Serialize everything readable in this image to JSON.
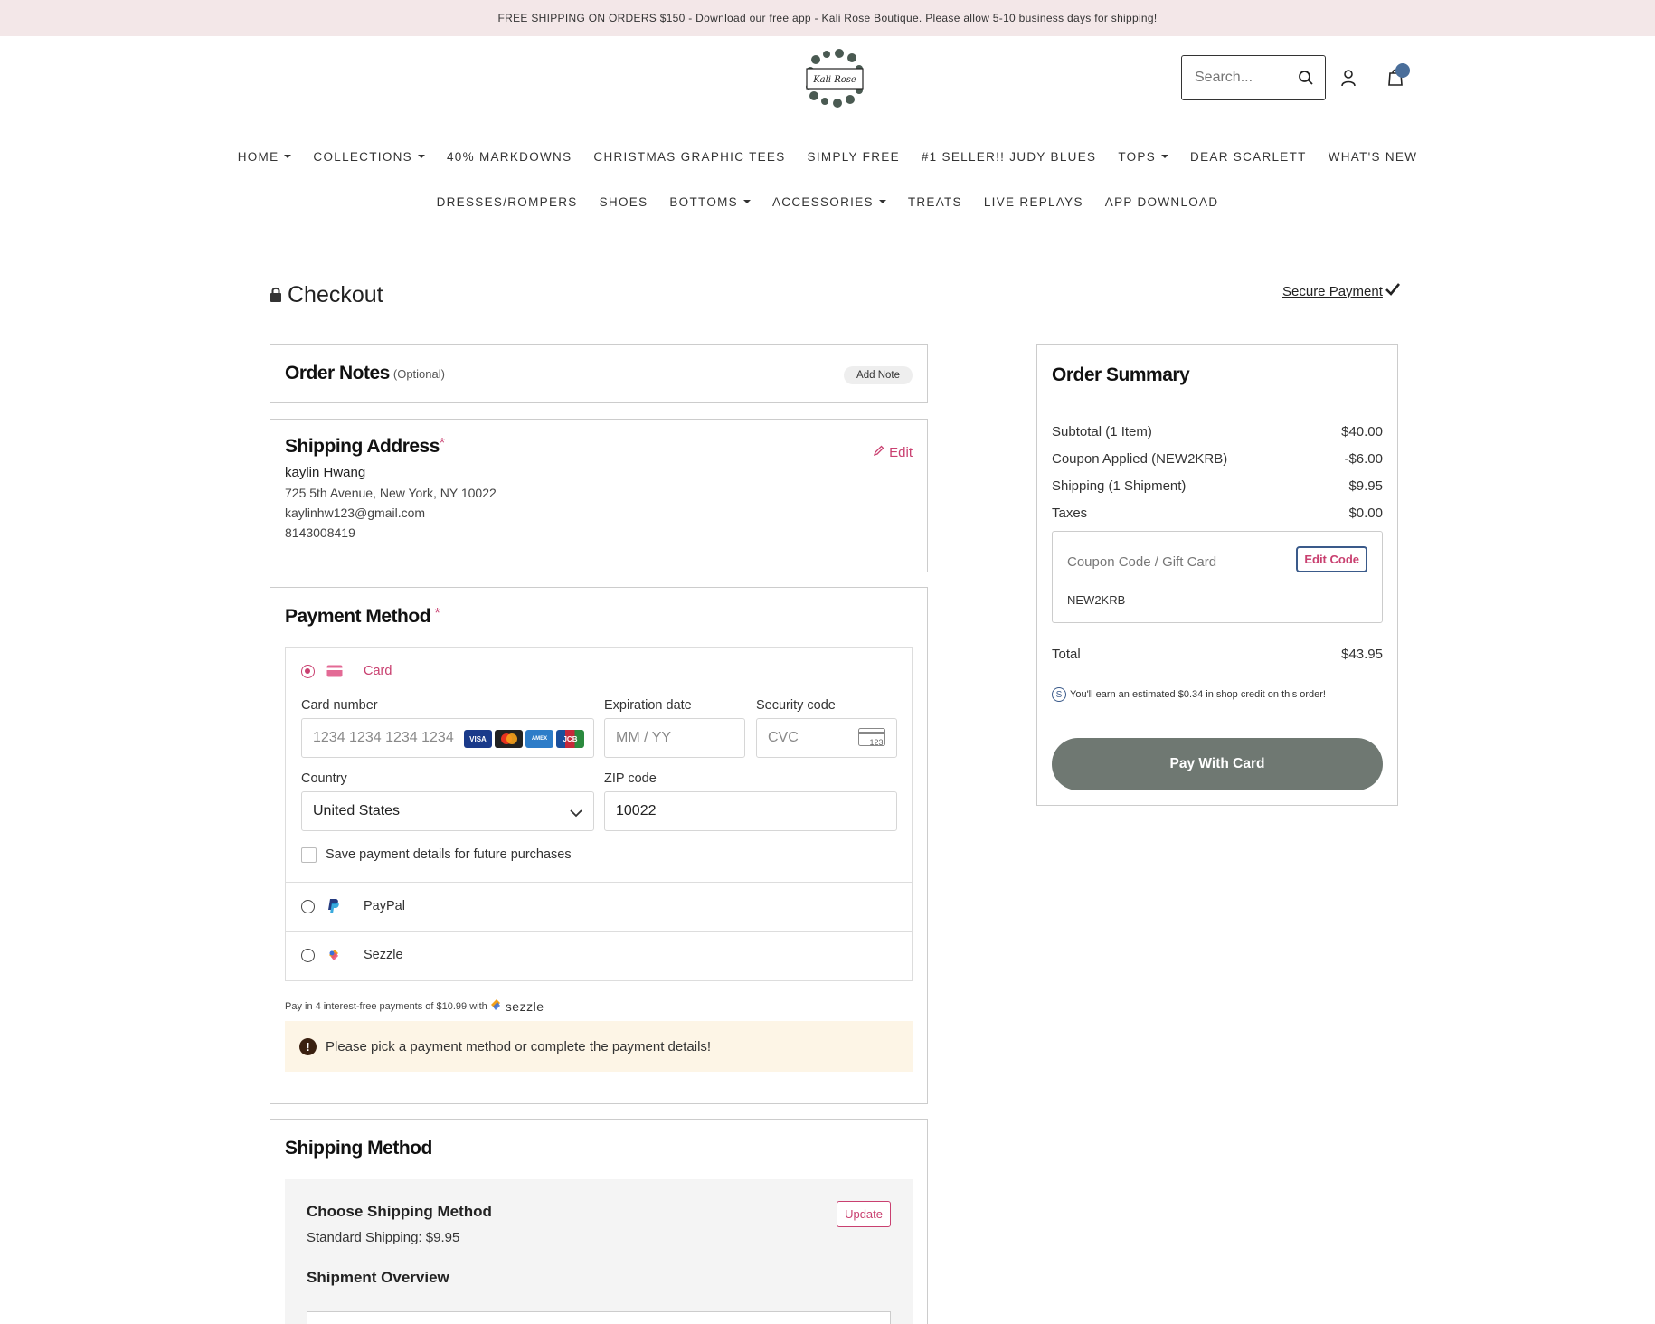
{
  "announcement": "FREE SHIPPING ON ORDERS $150 - Download our free app - Kali Rose Boutique. Please allow 5-10 business days for shipping!",
  "header": {
    "logo_text": "Kali Rose",
    "search_placeholder": "Search..."
  },
  "nav": {
    "row1": [
      {
        "label": "HOME",
        "dropdown": true
      },
      {
        "label": "COLLECTIONS",
        "dropdown": true
      },
      {
        "label": "40% MARKDOWNS",
        "dropdown": false
      },
      {
        "label": "CHRISTMAS GRAPHIC TEES",
        "dropdown": false
      },
      {
        "label": "SIMPLY FREE",
        "dropdown": false
      },
      {
        "label": "#1 SELLER!! JUDY BLUES",
        "dropdown": false
      },
      {
        "label": "TOPS",
        "dropdown": true
      },
      {
        "label": "DEAR SCARLETT",
        "dropdown": false
      },
      {
        "label": "WHAT'S NEW",
        "dropdown": false
      }
    ],
    "row2": [
      {
        "label": "DRESSES/ROMPERS",
        "dropdown": false
      },
      {
        "label": "SHOES",
        "dropdown": false
      },
      {
        "label": "BOTTOMS",
        "dropdown": true
      },
      {
        "label": "ACCESSORIES",
        "dropdown": true
      },
      {
        "label": "TREATS",
        "dropdown": false
      },
      {
        "label": "LIVE REPLAYS",
        "dropdown": false
      },
      {
        "label": "APP DOWNLOAD",
        "dropdown": false
      }
    ]
  },
  "checkout": {
    "title": "Checkout",
    "secure_payment": "Secure Payment"
  },
  "order_notes": {
    "title": "Order Notes",
    "optional": "(Optional)",
    "add_note": "Add Note"
  },
  "shipping_address": {
    "title": "Shipping Address",
    "required_mark": "*",
    "edit": "Edit",
    "name": "kaylin Hwang",
    "address": "725 5th Avenue, New York, NY 10022",
    "email": "kaylinhw123@gmail.com",
    "phone": "8143008419"
  },
  "payment": {
    "title": "Payment Method",
    "required_mark": "*",
    "card_label": "Card",
    "card_number_label": "Card number",
    "card_number_placeholder": "1234 1234 1234 1234",
    "card_brands": [
      "VISA",
      "MC",
      "AMEX",
      "JCB"
    ],
    "expiry_label": "Expiration date",
    "expiry_placeholder": "MM / YY",
    "cvc_label": "Security code",
    "cvc_placeholder": "CVC",
    "cvc_icon_text": "123",
    "country_label": "Country",
    "country_value": "United States",
    "zip_label": "ZIP code",
    "zip_value": "10022",
    "save_details": "Save payment details for future purchases",
    "paypal_label": "PayPal",
    "sezzle_label": "Sezzle",
    "sezzle_note": "Pay in 4 interest-free payments of $10.99 with",
    "sezzle_word": "sezzle",
    "warning": "Please pick a payment method or complete the payment details!",
    "colors": {
      "accent": "#c94070",
      "warning_bg": "#fdf5e6"
    }
  },
  "shipping_method": {
    "title": "Shipping Method",
    "choose": "Choose Shipping Method",
    "update": "Update",
    "standard": "Standard Shipping: $9.95",
    "overview": "Shipment Overview"
  },
  "summary": {
    "title": "Order Summary",
    "rows": [
      {
        "label": "Subtotal (1 Item)",
        "value": "$40.00"
      },
      {
        "label": "Coupon Applied (NEW2KRB)",
        "value": "-$6.00"
      },
      {
        "label": "Shipping (1 Shipment)",
        "value": "$9.95"
      },
      {
        "label": "Taxes",
        "value": "$0.00"
      }
    ],
    "coupon_placeholder": "Coupon Code / Gift Card",
    "edit_code": "Edit Code",
    "coupon_value": "NEW2KRB",
    "total_label": "Total",
    "total_value": "$43.95",
    "credit_icon_text": "S",
    "credit_note": "You'll earn an estimated $0.34 in shop credit on this order!",
    "pay_button": "Pay With Card",
    "colors": {
      "pay_button": "#6f7872"
    }
  }
}
